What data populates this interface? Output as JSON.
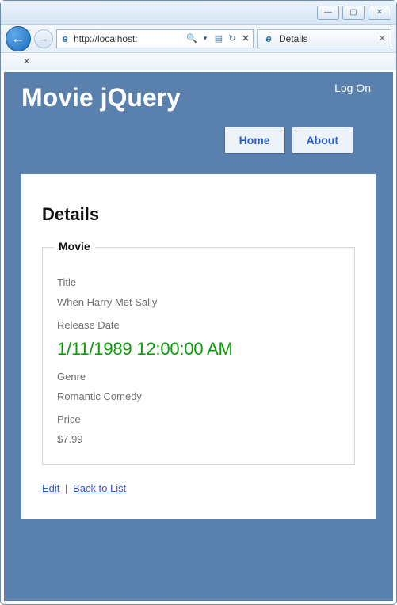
{
  "window": {
    "minimize_glyph": "—",
    "maximize_glyph": "▢",
    "close_glyph": "✕"
  },
  "browser": {
    "back_glyph": "←",
    "fwd_glyph": "→",
    "url": "http://localhost:",
    "search_glyph": "🔍",
    "dropdown_glyph": "▾",
    "compat_glyph": "▤",
    "refresh_glyph": "↻",
    "stop_glyph": "✕",
    "ie_glyph": "e",
    "tab_title": "Details",
    "tab_close": "✕",
    "subbar_close": "✕"
  },
  "header": {
    "logon": "Log On",
    "site_title": "Movie jQuery"
  },
  "menu": {
    "home": "Home",
    "about": "About"
  },
  "page": {
    "heading": "Details",
    "legend": "Movie",
    "fields": {
      "title_label": "Title",
      "title_value": "When Harry Met Sally",
      "releasedate_label": "Release Date",
      "releasedate_value": "1/11/1989 12:00:00 AM",
      "genre_label": "Genre",
      "genre_value": "Romantic Comedy",
      "price_label": "Price",
      "price_value": "$7.99"
    },
    "actions": {
      "edit": "Edit",
      "separator": "|",
      "back": "Back to List"
    }
  }
}
